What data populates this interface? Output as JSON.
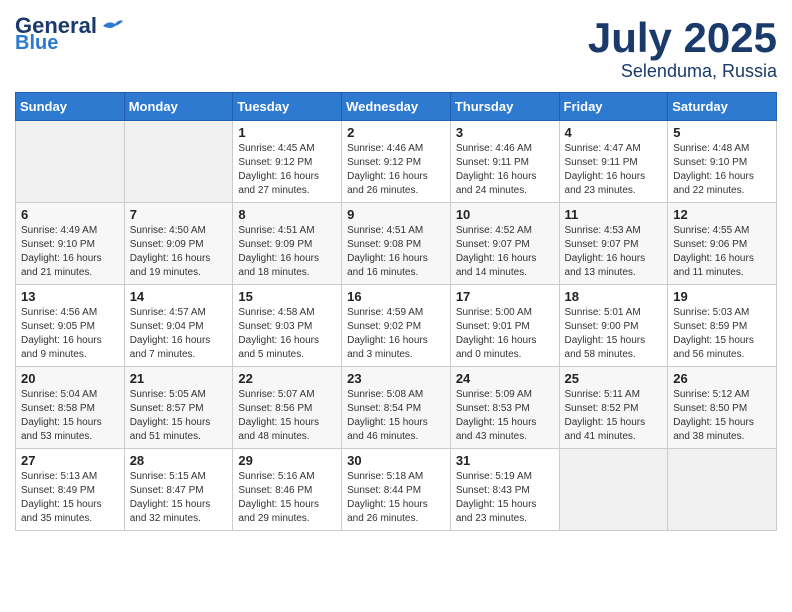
{
  "header": {
    "logo_line1": "General",
    "logo_line2": "Blue",
    "month": "July 2025",
    "location": "Selenduma, Russia"
  },
  "weekdays": [
    "Sunday",
    "Monday",
    "Tuesday",
    "Wednesday",
    "Thursday",
    "Friday",
    "Saturday"
  ],
  "weeks": [
    [
      {
        "day": "",
        "info": ""
      },
      {
        "day": "",
        "info": ""
      },
      {
        "day": "1",
        "info": "Sunrise: 4:45 AM\nSunset: 9:12 PM\nDaylight: 16 hours\nand 27 minutes."
      },
      {
        "day": "2",
        "info": "Sunrise: 4:46 AM\nSunset: 9:12 PM\nDaylight: 16 hours\nand 26 minutes."
      },
      {
        "day": "3",
        "info": "Sunrise: 4:46 AM\nSunset: 9:11 PM\nDaylight: 16 hours\nand 24 minutes."
      },
      {
        "day": "4",
        "info": "Sunrise: 4:47 AM\nSunset: 9:11 PM\nDaylight: 16 hours\nand 23 minutes."
      },
      {
        "day": "5",
        "info": "Sunrise: 4:48 AM\nSunset: 9:10 PM\nDaylight: 16 hours\nand 22 minutes."
      }
    ],
    [
      {
        "day": "6",
        "info": "Sunrise: 4:49 AM\nSunset: 9:10 PM\nDaylight: 16 hours\nand 21 minutes."
      },
      {
        "day": "7",
        "info": "Sunrise: 4:50 AM\nSunset: 9:09 PM\nDaylight: 16 hours\nand 19 minutes."
      },
      {
        "day": "8",
        "info": "Sunrise: 4:51 AM\nSunset: 9:09 PM\nDaylight: 16 hours\nand 18 minutes."
      },
      {
        "day": "9",
        "info": "Sunrise: 4:51 AM\nSunset: 9:08 PM\nDaylight: 16 hours\nand 16 minutes."
      },
      {
        "day": "10",
        "info": "Sunrise: 4:52 AM\nSunset: 9:07 PM\nDaylight: 16 hours\nand 14 minutes."
      },
      {
        "day": "11",
        "info": "Sunrise: 4:53 AM\nSunset: 9:07 PM\nDaylight: 16 hours\nand 13 minutes."
      },
      {
        "day": "12",
        "info": "Sunrise: 4:55 AM\nSunset: 9:06 PM\nDaylight: 16 hours\nand 11 minutes."
      }
    ],
    [
      {
        "day": "13",
        "info": "Sunrise: 4:56 AM\nSunset: 9:05 PM\nDaylight: 16 hours\nand 9 minutes."
      },
      {
        "day": "14",
        "info": "Sunrise: 4:57 AM\nSunset: 9:04 PM\nDaylight: 16 hours\nand 7 minutes."
      },
      {
        "day": "15",
        "info": "Sunrise: 4:58 AM\nSunset: 9:03 PM\nDaylight: 16 hours\nand 5 minutes."
      },
      {
        "day": "16",
        "info": "Sunrise: 4:59 AM\nSunset: 9:02 PM\nDaylight: 16 hours\nand 3 minutes."
      },
      {
        "day": "17",
        "info": "Sunrise: 5:00 AM\nSunset: 9:01 PM\nDaylight: 16 hours\nand 0 minutes."
      },
      {
        "day": "18",
        "info": "Sunrise: 5:01 AM\nSunset: 9:00 PM\nDaylight: 15 hours\nand 58 minutes."
      },
      {
        "day": "19",
        "info": "Sunrise: 5:03 AM\nSunset: 8:59 PM\nDaylight: 15 hours\nand 56 minutes."
      }
    ],
    [
      {
        "day": "20",
        "info": "Sunrise: 5:04 AM\nSunset: 8:58 PM\nDaylight: 15 hours\nand 53 minutes."
      },
      {
        "day": "21",
        "info": "Sunrise: 5:05 AM\nSunset: 8:57 PM\nDaylight: 15 hours\nand 51 minutes."
      },
      {
        "day": "22",
        "info": "Sunrise: 5:07 AM\nSunset: 8:56 PM\nDaylight: 15 hours\nand 48 minutes."
      },
      {
        "day": "23",
        "info": "Sunrise: 5:08 AM\nSunset: 8:54 PM\nDaylight: 15 hours\nand 46 minutes."
      },
      {
        "day": "24",
        "info": "Sunrise: 5:09 AM\nSunset: 8:53 PM\nDaylight: 15 hours\nand 43 minutes."
      },
      {
        "day": "25",
        "info": "Sunrise: 5:11 AM\nSunset: 8:52 PM\nDaylight: 15 hours\nand 41 minutes."
      },
      {
        "day": "26",
        "info": "Sunrise: 5:12 AM\nSunset: 8:50 PM\nDaylight: 15 hours\nand 38 minutes."
      }
    ],
    [
      {
        "day": "27",
        "info": "Sunrise: 5:13 AM\nSunset: 8:49 PM\nDaylight: 15 hours\nand 35 minutes."
      },
      {
        "day": "28",
        "info": "Sunrise: 5:15 AM\nSunset: 8:47 PM\nDaylight: 15 hours\nand 32 minutes."
      },
      {
        "day": "29",
        "info": "Sunrise: 5:16 AM\nSunset: 8:46 PM\nDaylight: 15 hours\nand 29 minutes."
      },
      {
        "day": "30",
        "info": "Sunrise: 5:18 AM\nSunset: 8:44 PM\nDaylight: 15 hours\nand 26 minutes."
      },
      {
        "day": "31",
        "info": "Sunrise: 5:19 AM\nSunset: 8:43 PM\nDaylight: 15 hours\nand 23 minutes."
      },
      {
        "day": "",
        "info": ""
      },
      {
        "day": "",
        "info": ""
      }
    ]
  ]
}
